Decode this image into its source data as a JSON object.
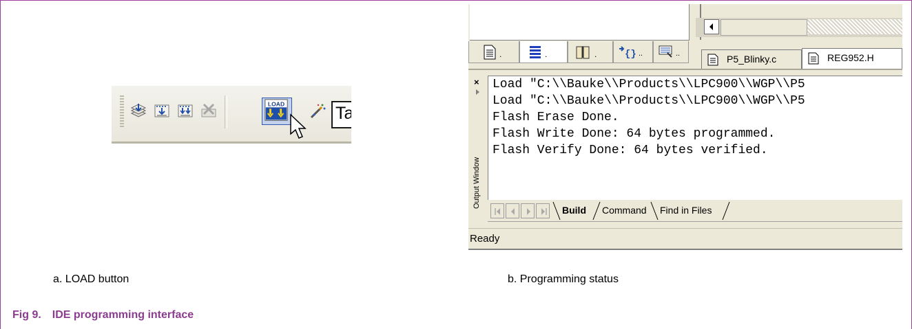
{
  "panel_a": {
    "load_button_label": "LOAD",
    "target_field_text": "Ta",
    "icons": [
      "build-icon",
      "download-icon",
      "batch-download-icon",
      "stop-build-icon",
      "load-icon",
      "magic-wand-icon"
    ]
  },
  "panel_b": {
    "project_tabs": [
      "files-tab-icon",
      "regs-tab-icon",
      "books-tab-icon",
      "functions-tab-icon",
      "templates-tab-icon"
    ],
    "file_tabs": [
      "P5_Blinky.c",
      "REG952.H"
    ],
    "output_window_label": "Output Window",
    "output_lines": [
      "Load \"C:\\\\Bauke\\\\Products\\\\LPC900\\\\WGP\\\\P5",
      "Load \"C:\\\\Bauke\\\\Products\\\\LPC900\\\\WGP\\\\P5",
      "Flash Erase Done.",
      "Flash Write Done: 64 bytes programmed.",
      "Flash Verify Done: 64 bytes verified."
    ],
    "output_tabs": [
      "Build",
      "Command",
      "Find in Files"
    ],
    "active_output_tab": "Build",
    "status": "Ready"
  },
  "captions": {
    "a": "a.   LOAD button",
    "b": "b.   Programming status",
    "figure_number": "Fig 9.",
    "figure_title": "IDE programming interface"
  },
  "colors": {
    "figure_caption": "#8a3c8f",
    "frame": "#9b3f9b",
    "ide_face": "#ece9d8"
  }
}
